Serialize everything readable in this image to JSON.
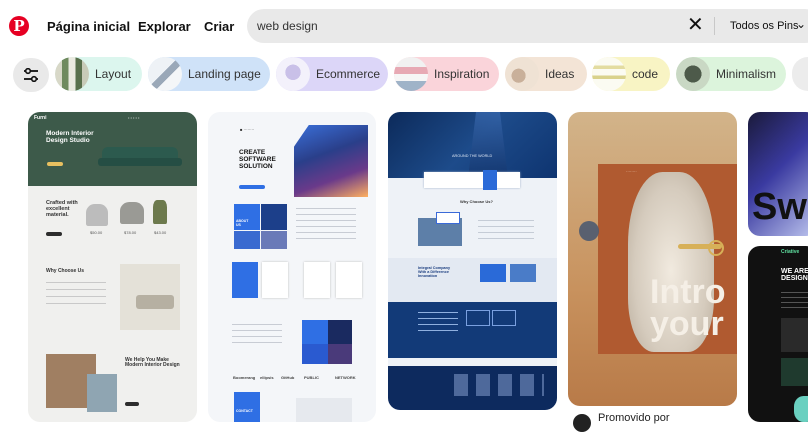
{
  "header": {
    "logo_icon": "pinterest-logo-icon",
    "logo_glyph": "P",
    "nav": {
      "home": "Página inicial",
      "explore": "Explorar",
      "create": "Criar"
    },
    "search": {
      "value": "web design",
      "clear_icon": "close-icon",
      "scope": "Todos os Pins",
      "scope_icon": "chevron-down-icon"
    }
  },
  "filters": {
    "filter_icon": "sliders-icon",
    "chips": [
      {
        "label": "Layout",
        "color": "#dcf6ee"
      },
      {
        "label": "Landing page",
        "color": "#cfe2f8"
      },
      {
        "label": "Ecommerce",
        "color": "#dcd6f8"
      },
      {
        "label": "Inspiration",
        "color": "#fad4da"
      },
      {
        "label": "Ideas",
        "color": "#f3e4d6"
      },
      {
        "label": "code",
        "color": "#f8f4c4"
      },
      {
        "label": "Minimalism",
        "color": "#dcf4dc"
      }
    ]
  },
  "pins": {
    "pin1": {
      "brand": "Furni",
      "hero_title": "Modern Interior\nDesign Studio",
      "crafted": "Crafted with\nexcellent\nmaterial.",
      "prices": [
        "$50.00",
        "$78.00",
        "$43.00"
      ],
      "why_title": "Why Choose Us",
      "help_title": "We Help You Make\nModern Interior Design"
    },
    "pin2": {
      "hero_title": "CREATE\nSOFTWARE\nSOLUTION",
      "about": "ABOUT\nUS",
      "logos": [
        "Boomerang",
        "ellipsis",
        "GitHub",
        "PUBLIC",
        "NETWORK"
      ],
      "contact": "CONTACT"
    },
    "pin3": {
      "hero_sub": "AROUND THE WORLD",
      "why_title": "Why Choose Us?",
      "integral": "Integral Company\nWith a Difference\nInnovation"
    },
    "pin4": {
      "overlay_text": "Intro\nyour",
      "promo_label": "Promovido por"
    },
    "pin5": {
      "big_text": "Sw",
      "creative_label": "Criative",
      "headline": "WE ARE\nDESIGN"
    }
  }
}
